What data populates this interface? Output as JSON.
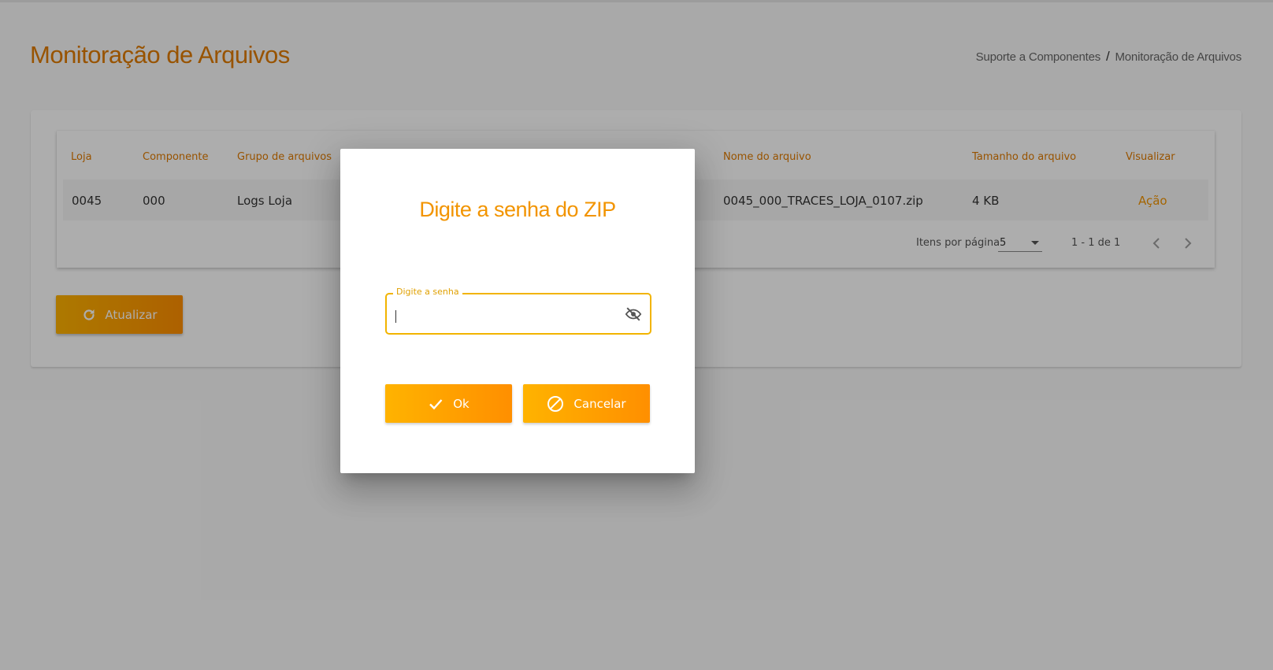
{
  "header": {
    "title": "Monitoração de Arquivos",
    "breadcrumb": {
      "parent": "Suporte a Componentes",
      "separator": "/",
      "current": "Monitoração de Arquivos"
    }
  },
  "table": {
    "columns": [
      "Loja",
      "Componente",
      "Grupo de arquivos",
      "Nome do arquivo",
      "Tamanho do arquivo",
      "Visualizar"
    ],
    "rows": [
      {
        "loja": "0045",
        "componente": "000",
        "grupo": "Logs Loja",
        "nome": "0045_000_TRACES_LOJA_0107.zip",
        "tamanho": "4 KB",
        "acao": "Ação"
      }
    ]
  },
  "paginator": {
    "items_per_page_label": "Itens por página",
    "page_size": "5",
    "range_label": "1 - 1 de 1",
    "prev_icon": "chevron-left-icon",
    "next_icon": "chevron-right-icon"
  },
  "actions": {
    "refresh_label": "Atualizar",
    "refresh_icon": "refresh-icon"
  },
  "dialog": {
    "title": "Digite a senha do ZIP",
    "password_field": {
      "label": "Digite a senha",
      "value": "",
      "toggle_icon": "eye-off-icon"
    },
    "ok_label": "Ok",
    "ok_icon": "check-icon",
    "cancel_label": "Cancelar",
    "cancel_icon": "block-icon"
  },
  "colors": {
    "accent": "#f29400",
    "title": "#e07b00",
    "button_start": "#ffb300",
    "button_end": "#ff8f00",
    "focus": "#f2b400"
  }
}
